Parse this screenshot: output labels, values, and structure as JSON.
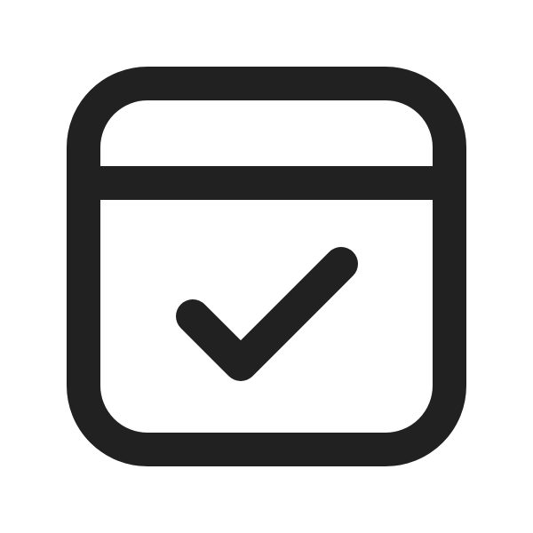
{
  "icon": {
    "name": "calendar-checkmark-icon",
    "stroke_color": "#212121",
    "background_color": "#ffffff"
  }
}
